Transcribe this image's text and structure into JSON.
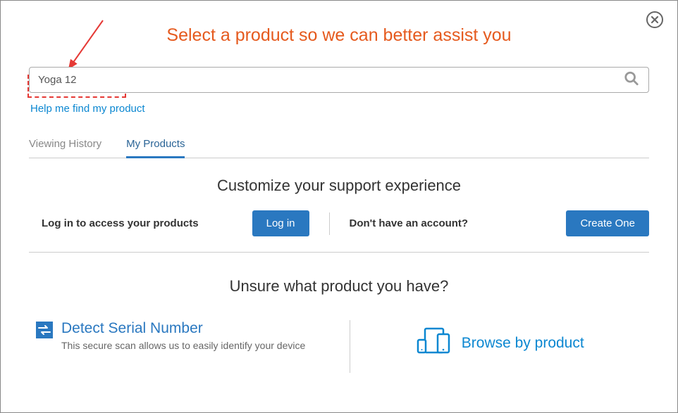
{
  "modal": {
    "title": "Select a product so we can better assist you"
  },
  "search": {
    "value": "Yoga 12"
  },
  "help_link": "Help me find my product",
  "tabs": [
    {
      "label": "Viewing History"
    },
    {
      "label": "My Products"
    }
  ],
  "customize": {
    "title": "Customize your support experience",
    "login_prompt": "Log in to access your products",
    "login_button": "Log in",
    "no_account_prompt": "Don't have an account?",
    "create_button": "Create One"
  },
  "unsure": {
    "title": "Unsure what product you have?",
    "detect": {
      "title": "Detect Serial Number",
      "desc": "This secure scan allows us to easily identify your device"
    },
    "browse": {
      "title": "Browse by product"
    }
  }
}
